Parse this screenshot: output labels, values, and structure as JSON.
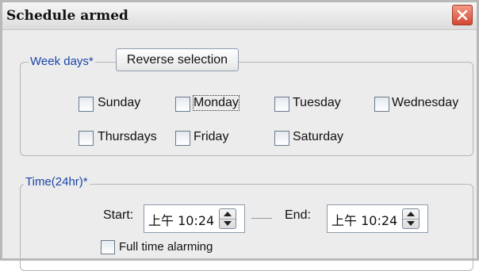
{
  "dialog": {
    "title": "Schedule armed"
  },
  "week_days": {
    "legend": "Week days*",
    "reverse_button": "Reverse selection",
    "days": [
      {
        "label": "Sunday",
        "checked": false
      },
      {
        "label": "Monday",
        "checked": false
      },
      {
        "label": "Tuesday",
        "checked": false
      },
      {
        "label": "Wednesday",
        "checked": false
      },
      {
        "label": "Thursdays",
        "checked": false
      },
      {
        "label": "Friday",
        "checked": false
      },
      {
        "label": "Saturday",
        "checked": false
      }
    ]
  },
  "time": {
    "legend": "Time(24hr)*",
    "start_label": "Start:",
    "start_value": "上午 10:24",
    "end_label": "End:",
    "end_value": "上午 10:24",
    "full_time_label": "Full time alarming",
    "full_time_checked": false
  },
  "colors": {
    "legend": "#1a45a8",
    "close_button": "#d4472e"
  },
  "icons": {
    "close": "close-icon",
    "spin_up": "arrow-up-icon",
    "spin_down": "arrow-down-icon"
  }
}
